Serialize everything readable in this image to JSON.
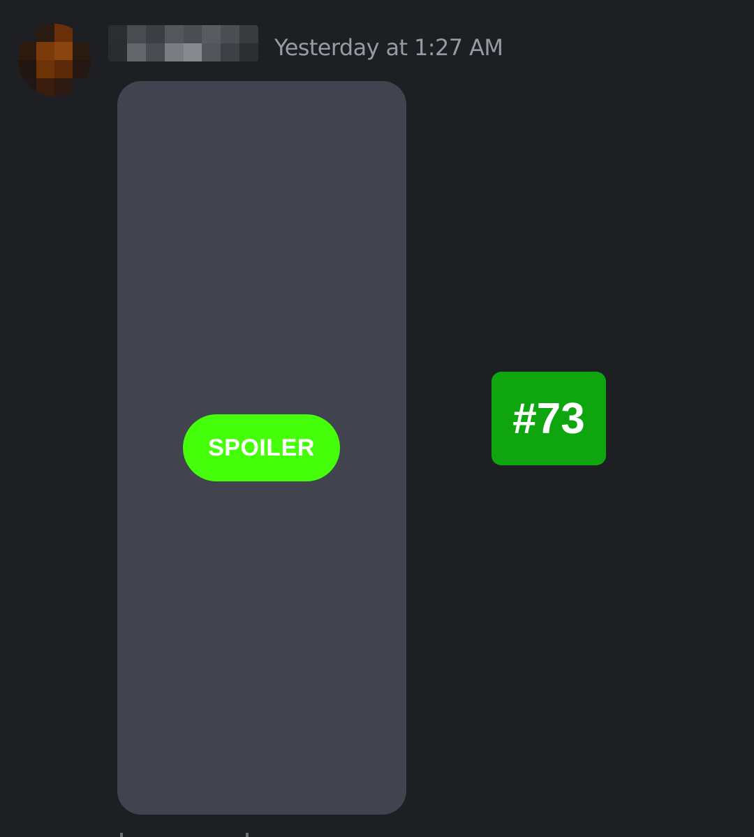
{
  "message": {
    "timestamp": "Yesterday at 1:27 AM",
    "attachment": {
      "spoiler_label": "SPOILER"
    },
    "tag": {
      "label": "#73"
    }
  },
  "colors": {
    "background": "#1e1f22",
    "attachment": "#41434e",
    "spoiler_badge": "#45ff0a",
    "tag": "#0fa50f",
    "timestamp": "#949ba4"
  },
  "icons": {
    "avatar": "pixelated-user-avatar",
    "username": "pixelated-username"
  }
}
